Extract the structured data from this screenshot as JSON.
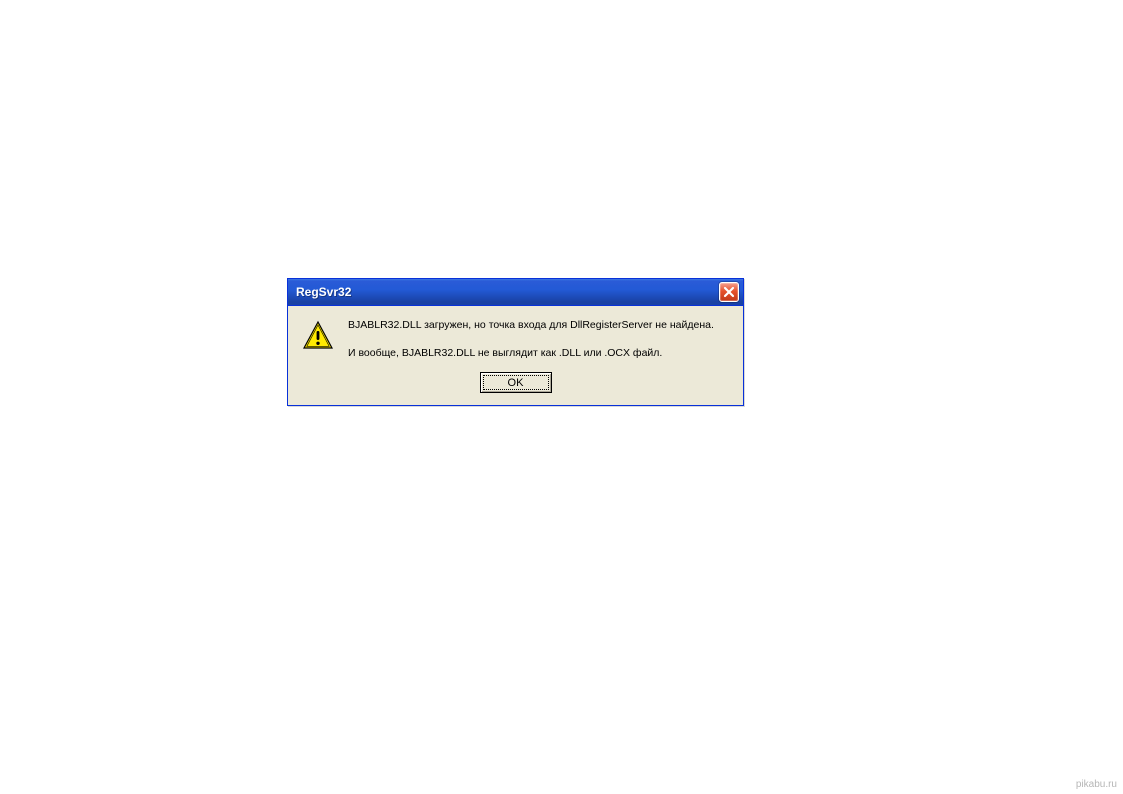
{
  "dialog": {
    "title": "RegSvr32",
    "message_line1": "BJABLR32.DLL загружен, но точка входа для DllRegisterServer не найдена.",
    "message_line2": "И вообще, BJABLR32.DLL не выглядит как .DLL или .OCX файл.",
    "ok_label": "OK",
    "icon": "warning-icon"
  },
  "watermark": "pikabu.ru"
}
